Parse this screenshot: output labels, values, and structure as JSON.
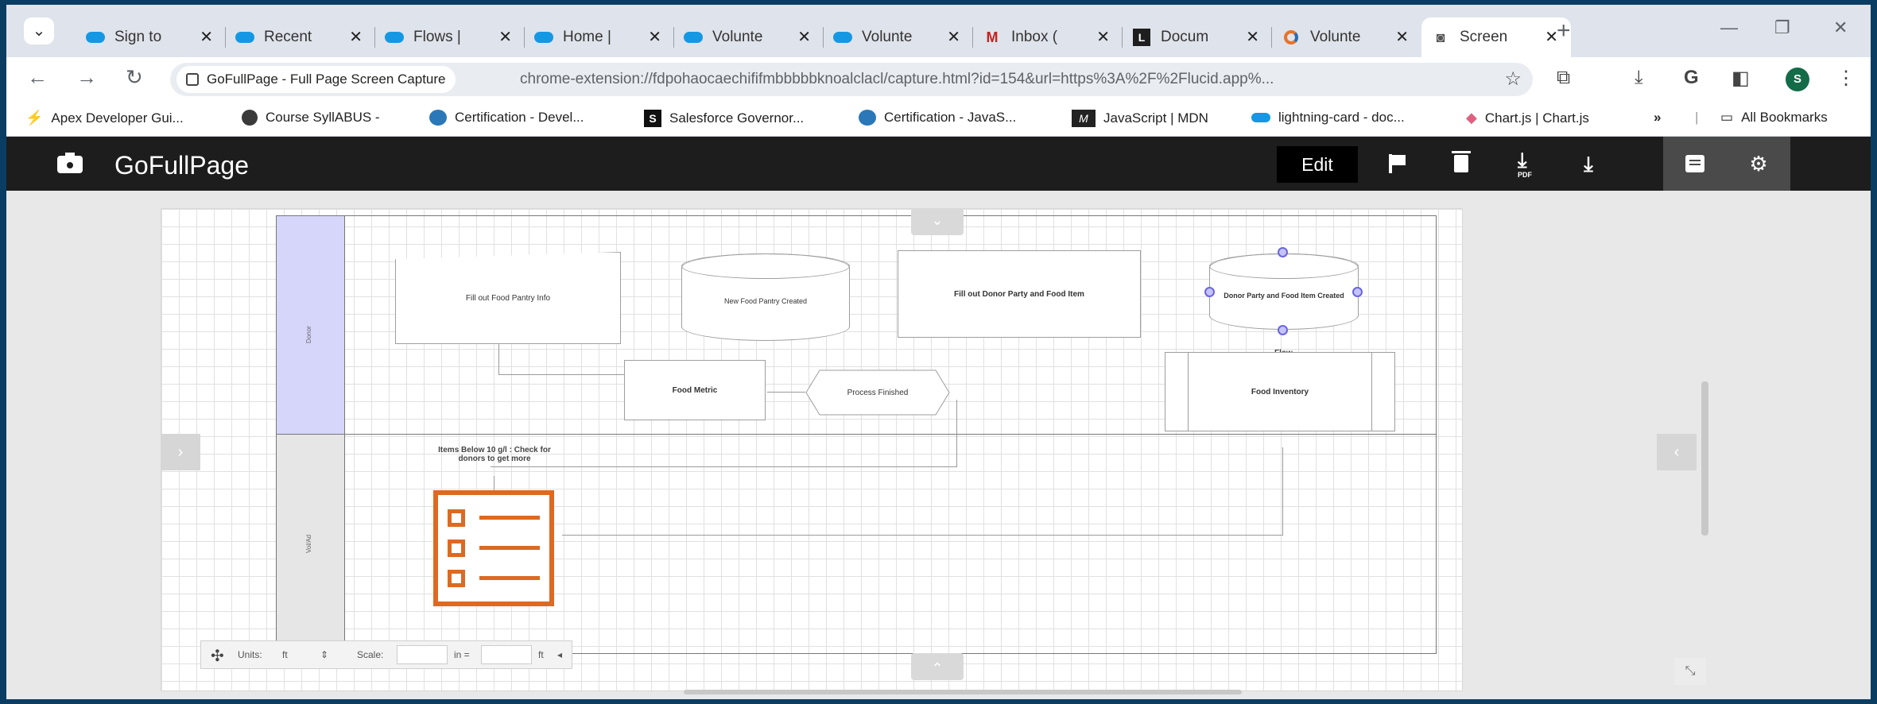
{
  "tabs": [
    {
      "title": "Sign to",
      "favicon": "salesforce-cloud-icon"
    },
    {
      "title": "Recent",
      "favicon": "salesforce-cloud-icon"
    },
    {
      "title": "Flows |",
      "favicon": "salesforce-cloud-icon"
    },
    {
      "title": "Home |",
      "favicon": "salesforce-cloud-icon"
    },
    {
      "title": "Volunte",
      "favicon": "salesforce-cloud-icon"
    },
    {
      "title": "Volunte",
      "favicon": "salesforce-cloud-icon"
    },
    {
      "title": "Inbox (",
      "favicon": "gmail-icon"
    },
    {
      "title": "Docum",
      "favicon": "document-icon"
    },
    {
      "title": "Volunte",
      "favicon": "volunteer-icon"
    },
    {
      "title": "Screen",
      "favicon": "camera-icon",
      "active": true
    }
  ],
  "toolbar": {
    "page_chip": "GoFullPage - Full Page Screen Capture",
    "url": "chrome-extension://fdpohaocaechififmbbbbbknoalclacl/capture.html?id=154&url=https%3A%2F%2Flucid.app%...",
    "profile_initial": "S"
  },
  "bookmarks": [
    {
      "label": "Apex Developer Gui...",
      "icon": "bolt-icon"
    },
    {
      "label": "Course SyllABUS -",
      "icon": "course-icon"
    },
    {
      "label": "Certification - Devel...",
      "icon": "trailhead-icon"
    },
    {
      "label": "Salesforce Governor...",
      "icon": "s-icon"
    },
    {
      "label": "Certification - JavaS...",
      "icon": "trailhead-icon"
    },
    {
      "label": "JavaScript | MDN",
      "icon": "mdn-icon"
    },
    {
      "label": "lightning-card - doc...",
      "icon": "salesforce-cloud-icon"
    },
    {
      "label": "Chart.js | Chart.js",
      "icon": "chartjs-icon"
    }
  ],
  "bookmarks_overflow": "»",
  "all_bookmarks": "All Bookmarks",
  "app": {
    "name": "GoFullPage",
    "edit_label": "Edit"
  },
  "diagram": {
    "lane_top_label": "Donor",
    "lane_bottom_label": "Vol/Ad",
    "fill_out_food_pantry": "Fill out Food Pantry  Info",
    "new_food_pantry_created": "New Food Pantry Created",
    "fill_out_donor_party": "Fill out Donor Party and Food Item",
    "donor_party_created": "Donor Party and Food Item Created",
    "flow_label": "Flow",
    "food_metric": "Food Metric",
    "process_finished": "Process Finished",
    "food_inventory": "Food Inventory",
    "items_below": "Items Below 10 g/l : Check for donors to get more"
  },
  "units_bar": {
    "units_label": "Units:",
    "units_value": "ft",
    "scale_label": "Scale:",
    "scale_unit_1": "in =",
    "scale_unit_2": "ft"
  }
}
